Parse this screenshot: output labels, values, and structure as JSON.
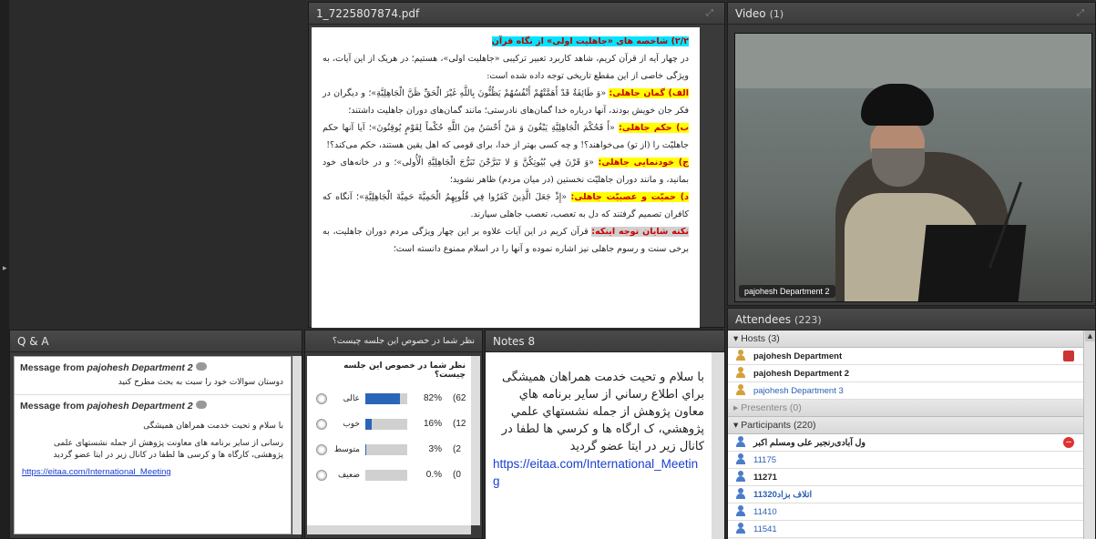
{
  "pdf": {
    "title": "1_7225807874.pdf",
    "heading": "۲/۲) شاخصه های «جاهلیت اولی» از نگاه قرآن",
    "p1": "در چهار آیه از قرآن کریم، شاهد کاربرد تعبیر ترکیبی «جاهلیت اولی»، هستیم؛ در هریک از این آیات، به ویژگی خاصی از این مقطع تاریخی توجه داده شده است:",
    "h_a": "الف) گمان جاهلی:",
    "p_a": "«وَ طَائِفَةٌ قَدْ أَهَمَّتْهُمْ أَنْفُسُهُمْ يَظُنُّونَ بِاللَّهِ غَيْرَ الْحَقِّ ظَنَّ الْجَاهِلِيَّةِ»؛ و دیگران در فکر جان خویش بودند، آنها درباره خدا گمان‌های نادرستی؛ مانند گمان‌های دوران جاهلیت داشتند؛",
    "h_b": "ب) حکم جاهلی:",
    "p_b": "«أَ فَحُكْمَ الْجَاهِلِيَّةِ يَبْغُونَ وَ مَنْ أَحْسَنُ مِنَ اللَّهِ حُكْماً لِقَوْمٍ يُوقِنُونَ»؛ آیا آنها حکم جاهلیّت را (از تو) می‌خواهند؟! و چه کسی بهتر از خدا، برای قومی که اهل یقین هستند، حکم می‌کند؟!",
    "h_c": "ج) خودنمایی جاهلی:",
    "p_c": "«وَ قَرْنَ فِي بُيُوتِكُنَّ وَ لا تَبَرَّجْنَ تَبَرُّجَ الْجَاهِلِيَّةِ الْأُولى»؛ و در خانه‌های خود بمانید، و مانند دوران جاهلیّت نخستین (در میان مردم) ظاهر نشوید؛",
    "h_d": "د) حمیّت و عصبیّت جاهلی:",
    "p_d": "«إِذْ جَعَلَ الَّذِينَ كَفَرُوا فِي قُلُوبِهِمُ الْحَمِيَّةَ حَمِيَّةَ الْجَاهِلِيَّةِ»؛ آنگاه که کافران تصمیم گرفتند که دل به تعصب، تعصب جاهلی سپارند.",
    "h_e": "نکته شایان توجه اینکه:",
    "p_e": "قرآن کریم در این آیات علاوه بر این چهار ویژگی مردم دوران جاهلیت، به برخی سنت و رسوم جاهلی نیز اشاره نموده و آنها را در اسلام ممنوع دانسته است؛"
  },
  "video": {
    "title": "Video",
    "count": "(1)",
    "speaker_label": "pajohesh Department 2"
  },
  "attendees": {
    "title": "Attendees",
    "count": "(223)",
    "hosts_label": "▾  Hosts (3)",
    "hosts": [
      "pajohesh Department",
      "pajohesh Department 2",
      "pajohesh Department 3"
    ],
    "presenters_label": "▸  Presenters (0)",
    "participants_label": "▾  Participants (220)",
    "participants": [
      "ول آبادی‌رنجبر علی ومسلم اکبر",
      "11175",
      "11271",
      "11320اتلاف بزاد",
      "11410",
      "11541"
    ]
  },
  "qa": {
    "title": "Q & A",
    "msg1_head": "Message from",
    "msg1_who": "pajohesh Department 2",
    "msg1_text": "دوستان سوالات خود را سبت به بحث مطرح کنید",
    "msg2_head": "Message from",
    "msg2_who": "pajohesh Department 2",
    "msg2_text": "با سلام و تحیت خدمت همراهان همیشگی",
    "msg2_text2": "رسانی از سایر برنامه های معاونت پژوهش از جمله نشستهای علمی پژوهشی، کارگاه ها و کرسی ها لطفا در کانال زیر در ایتا عضو گردید",
    "msg2_link": "https://eitaa.com/International_Meeting"
  },
  "poll": {
    "title": "نظر شما در خصوص این جلسه چیست؟",
    "question": "نظر شما در خصوص این جلسه چیست؟",
    "options": [
      {
        "label": "عالی",
        "pct": "82%",
        "value": 0.82,
        "count": "(62"
      },
      {
        "label": "خوب",
        "pct": "16%",
        "value": 0.16,
        "count": "(12"
      },
      {
        "label": "متوسط",
        "pct": "3%",
        "value": 0.03,
        "count": "(2"
      },
      {
        "label": "ضعیف",
        "pct": "0.%",
        "value": 0.0,
        "count": "(0"
      }
    ]
  },
  "notes": {
    "title": "Notes 8",
    "text": "با سلام و تحیت خدمت همراهان همیشگی براي اطلاع رساني از ساير برنامه هاي معاون پژوهش از جمله نشستهاي علمي پژوهشي، ک ارگاه ها و کرسي ها لطفا در کانال زير در ايتا عضو گرديد",
    "link": "https://eitaa.com/International_Meeting"
  },
  "colors": {
    "accent_blue": "#2b65b8",
    "highlight_cyan": "#00e5ff",
    "highlight_yellow": "#ffff00"
  }
}
